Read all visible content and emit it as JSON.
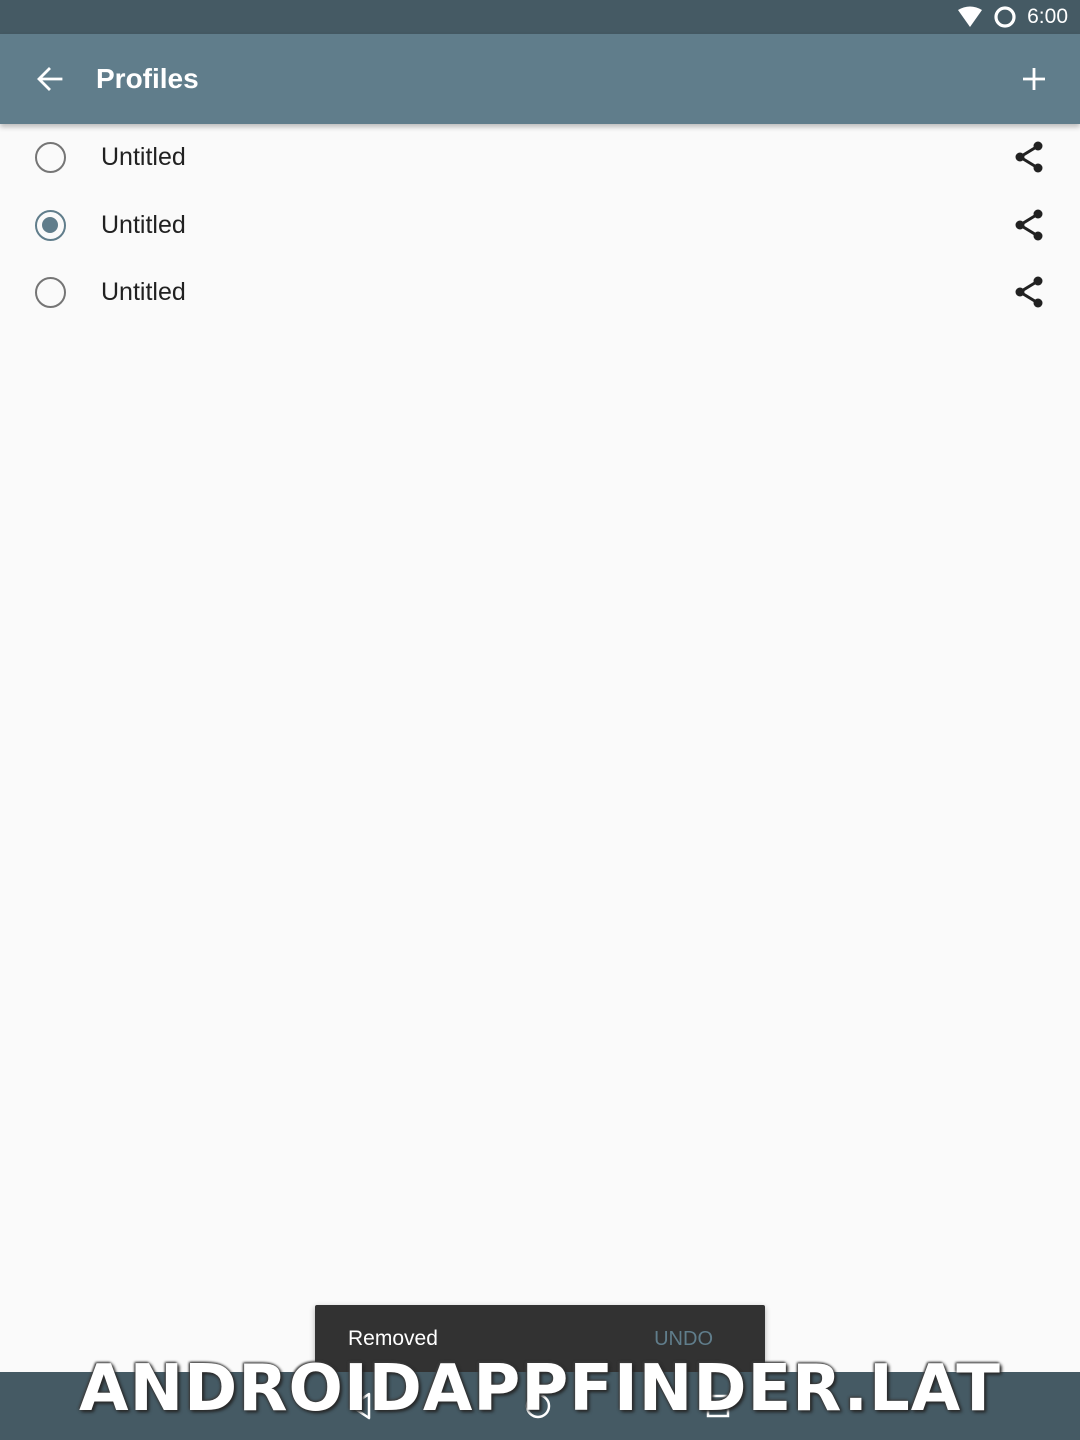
{
  "status_bar": {
    "time": "6:00",
    "icons": [
      "wifi-icon",
      "alarm-icon"
    ]
  },
  "app_bar": {
    "title": "Profiles",
    "back_icon": "arrow-left-icon",
    "add_icon": "plus-icon"
  },
  "profiles": [
    {
      "name": "Untitled",
      "selected": false
    },
    {
      "name": "Untitled",
      "selected": true
    },
    {
      "name": "Untitled",
      "selected": false
    }
  ],
  "snackbar": {
    "message": "Removed",
    "action": "UNDO"
  },
  "nav_bar": {
    "buttons": [
      "back-icon",
      "home-icon",
      "recents-icon"
    ]
  },
  "watermark": "ANDROIDAPPFINDER.LAT",
  "colors": {
    "primary": "#607d8b",
    "primary_dark": "#455a64",
    "background": "#fafafa",
    "snackbar": "#323232"
  }
}
